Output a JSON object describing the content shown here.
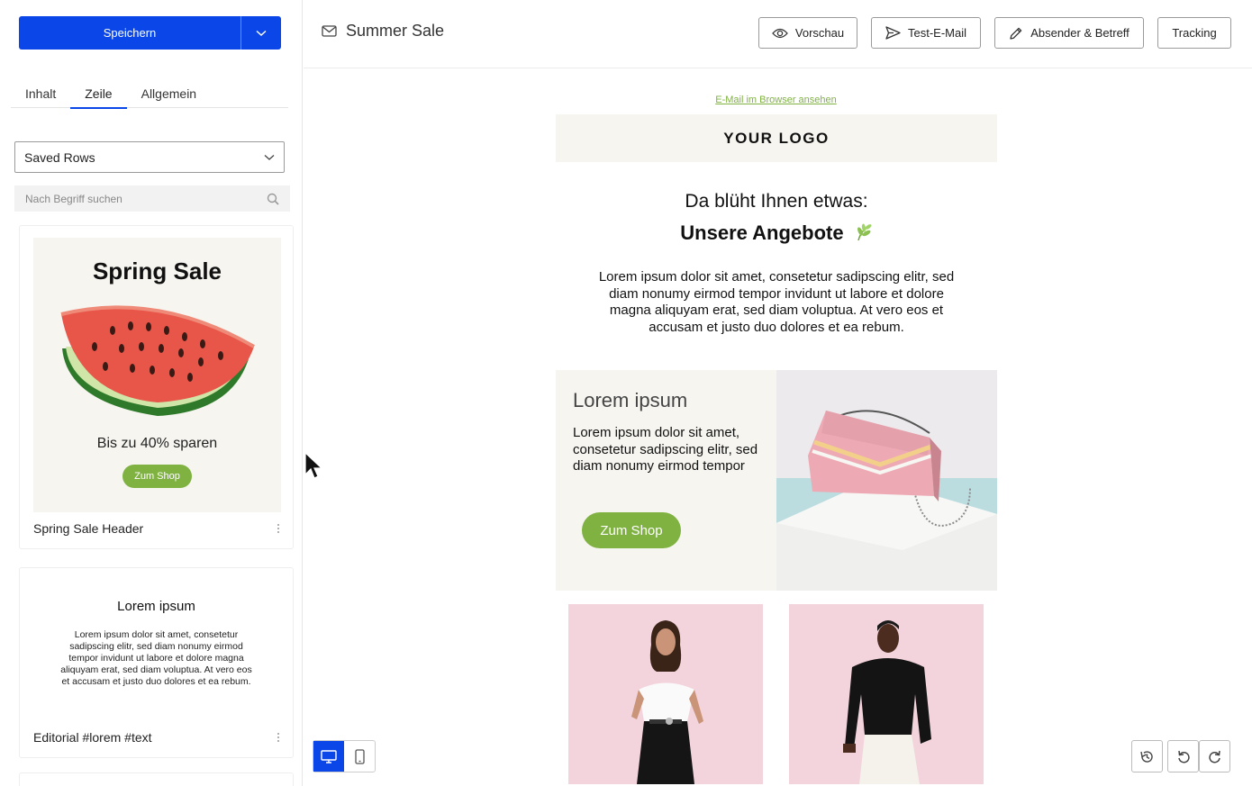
{
  "sidebar": {
    "save_label": "Speichern",
    "tabs": [
      {
        "label": "Inhalt",
        "active": false
      },
      {
        "label": "Zeile",
        "active": true
      },
      {
        "label": "Allgemein",
        "active": false
      }
    ],
    "select_value": "Saved Rows",
    "search_placeholder": "Nach Begriff suchen",
    "cards": [
      {
        "preview_title": "Spring Sale",
        "preview_subtitle": "Bis zu 40% sparen",
        "preview_button": "Zum Shop",
        "label": "Spring Sale Header"
      },
      {
        "preview_title": "Lorem ipsum",
        "preview_body": "Lorem ipsum dolor sit amet, consetetur sadipscing elitr, sed diam nonumy eirmod tempor invidunt ut labore et dolore magna aliquyam erat, sed diam voluptua. At vero eos et accusam et justo duo dolores et ea rebum.",
        "label": "Editorial #lorem #text"
      }
    ]
  },
  "topbar": {
    "subject": "Summer Sale",
    "buttons": {
      "preview": "Vorschau",
      "test_mail": "Test-E-Mail",
      "sender": "Absender & Betreff",
      "tracking": "Tracking"
    }
  },
  "email": {
    "browser_link": "E-Mail im Browser ansehen",
    "logo": "YOUR LOGO",
    "headline1": "Da blüht Ihnen etwas:",
    "headline2": "Unsere Angebote",
    "intro": "Lorem ipsum dolor sit amet, consetetur sadipscing elitr, sed diam nonumy eirmod tempor invidunt ut labore et dolore magna aliquyam erat, sed diam voluptua. At vero eos et accusam et justo duo dolores et ea rebum.",
    "promo": {
      "heading": "Lorem ipsum",
      "text": "Lorem ipsum dolor sit amet, consetetur sadipscing elitr, sed diam nonumy eirmod tempor",
      "button": "Zum Shop"
    }
  },
  "colors": {
    "primary": "#0a46e8",
    "accent_green": "#7fb241",
    "cream": "#f6f5f0",
    "pink": "#f3d3dc"
  }
}
